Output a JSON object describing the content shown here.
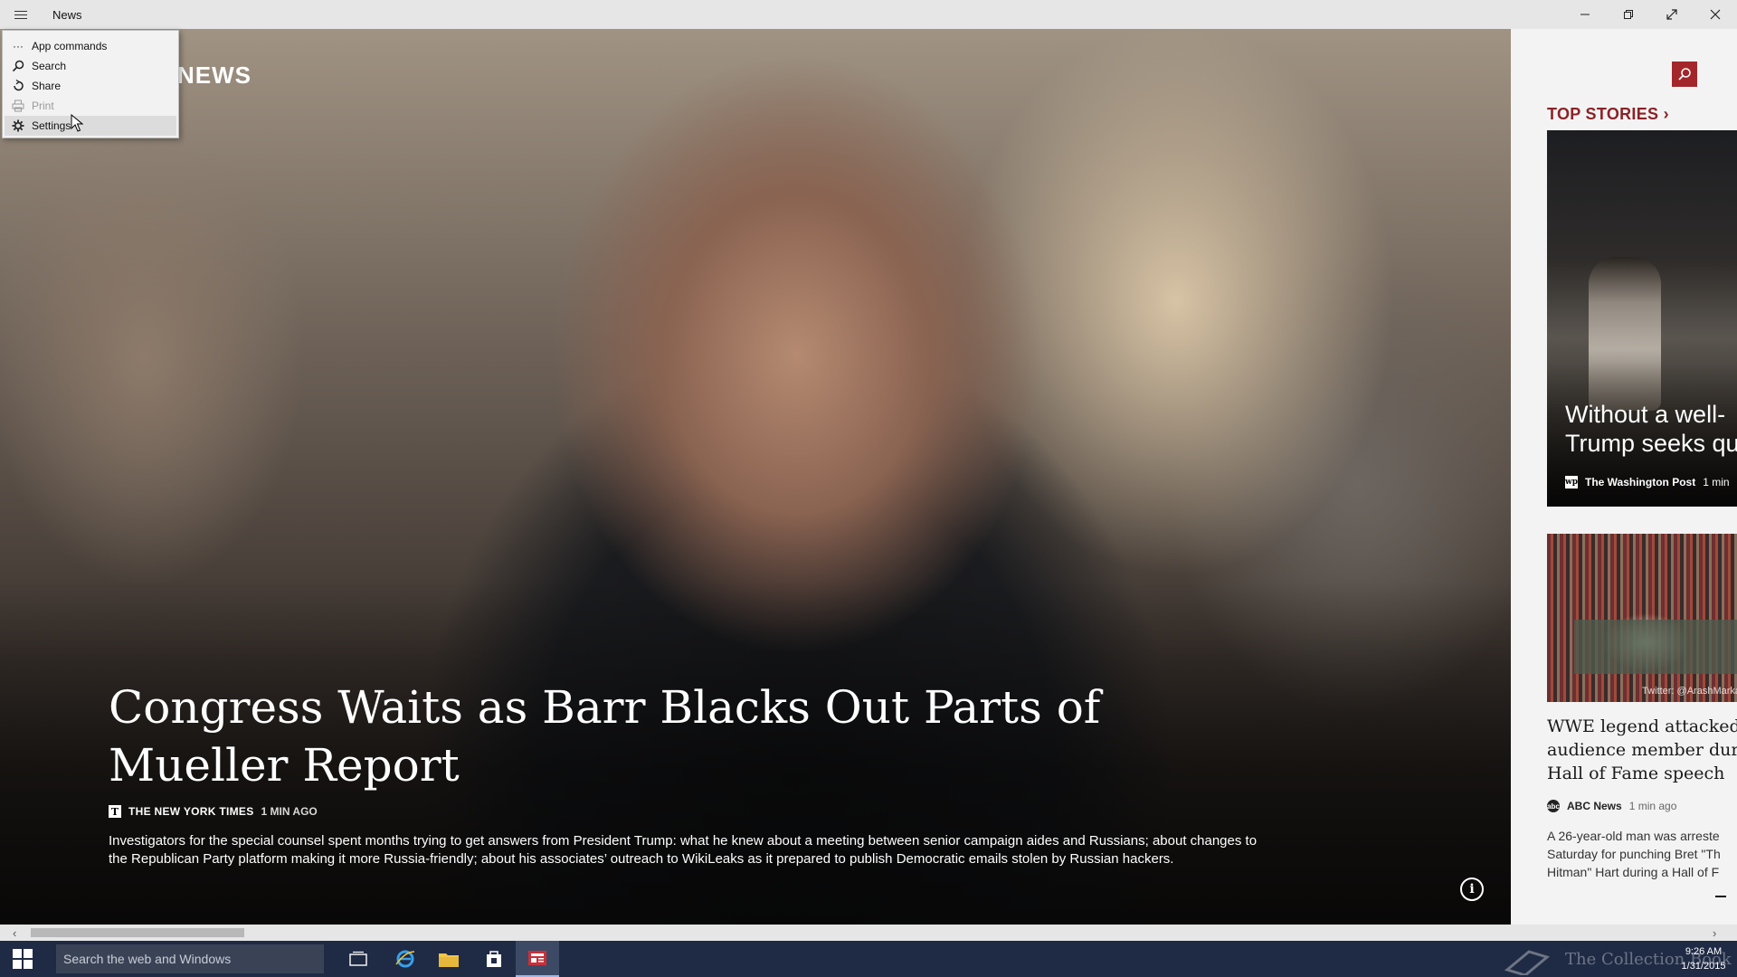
{
  "window": {
    "title": "News"
  },
  "menu": {
    "items": [
      {
        "label": "App commands",
        "icon": "more-icon",
        "enabled": true
      },
      {
        "label": "Search",
        "icon": "search-icon",
        "enabled": true
      },
      {
        "label": "Share",
        "icon": "share-icon",
        "enabled": true
      },
      {
        "label": "Print",
        "icon": "print-icon",
        "enabled": false
      },
      {
        "label": "Settings",
        "icon": "gear-icon",
        "enabled": true,
        "hovered": true
      }
    ]
  },
  "hero": {
    "logo": "NEWS",
    "headline": "Congress Waits as Barr Blacks Out Parts of Mueller Report",
    "source_name": "THE NEW YORK TIMES",
    "source_time": "1 MIN AGO",
    "summary": "Investigators for the special counsel spent months trying to get answers from President Trump: what he knew about a meeting between senior campaign aides and Russians; about changes to the Republican Party platform making it more Russia-friendly; about his associates’ outreach to WikiLeaks as it prepared to publish Democratic emails stolen by Russian hackers."
  },
  "right_panel": {
    "section_label": "TOP STORIES",
    "story1": {
      "title": "Without a well-\nTrump seeks qu",
      "source_name": "The Washington Post",
      "source_time": "1 min"
    },
    "story2": {
      "image_caption": "Twitter: @ArashMarka",
      "title": "WWE legend attacked\naudience member dur\nHall of Fame speech",
      "source_name": "ABC News",
      "source_time": "1 min ago",
      "summary": "A 26-year-old man was arreste\nSaturday for punching Bret \"Th\nHitman\" Hart during a Hall of F"
    }
  },
  "taskbar": {
    "search_placeholder": "Search the web and Windows",
    "watermark": "The Collection Book",
    "time": "9:26 AM",
    "date": "1/31/2015"
  },
  "colors": {
    "accent": "#a3262a",
    "taskbar": "#1f2a44",
    "titlebar": "#e6e6e6"
  }
}
